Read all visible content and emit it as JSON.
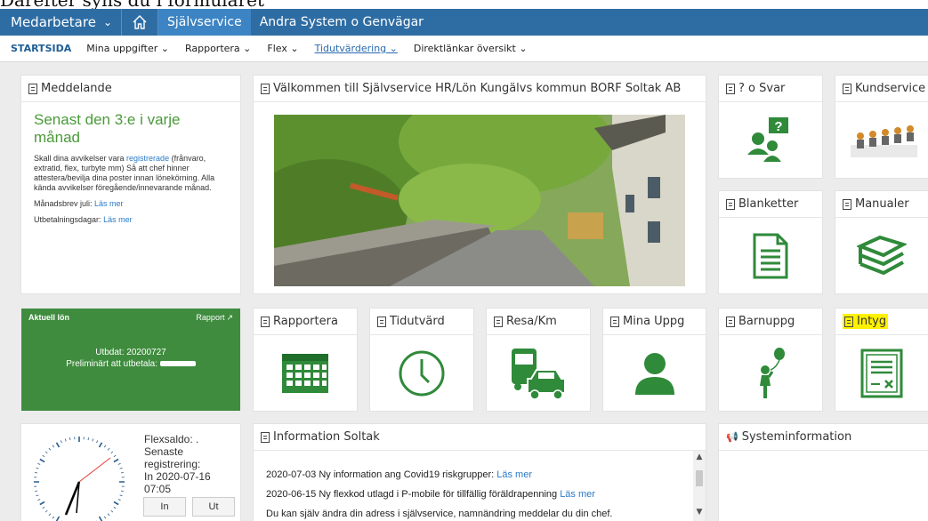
{
  "caption": "Därefter syns du i formuläret",
  "topbar": {
    "role": "Medarbetare",
    "role_caret": "⌄",
    "tabs": [
      "Självservice",
      "Andra System o Genvägar"
    ]
  },
  "subnav": {
    "items": [
      "STARTSIDA",
      "Mina uppgifter ⌄",
      "Rapportera ⌄",
      "Flex ⌄",
      "Tidutvärdering ⌄",
      "Direktlänkar översikt ⌄"
    ]
  },
  "tiles": {
    "meddelande": "Meddelande",
    "valkommen": "Välkommen till Självservice HR/Lön Kungälvs kommun BORF Soltak AB",
    "q_svar": "? o Svar",
    "kundservice": "Kundservice",
    "blanketter": "Blanketter",
    "manualer": "Manualer",
    "rapportera": "Rapportera",
    "tidutvard": "Tidutvärd",
    "resa": "Resa/Km",
    "mina_uppg": "Mina Uppg",
    "barnuppg": "Barnuppg",
    "intyg": "Intyg",
    "information": "Information Soltak",
    "systeminfo": "Systeminformation"
  },
  "meddelande": {
    "title": "Senast den 3:e i varje månad",
    "text_before": "Skall dina avvikelser vara ",
    "text_link": "registrerade",
    "text_after": " (frånvaro, extratid, flex, turbyte mm) Så att chef hinner attestera/bevilja dina poster innan lönekörning. Alla kända avvikelser föregående/innevarande månad.",
    "manadsbrev_label": "Månadsbrev juli: ",
    "manadsbrev_link": "Läs mer",
    "utbetalning_label": "Utbetalningsdagar: ",
    "utbetalning_link": "Läs mer"
  },
  "lon": {
    "title": "Aktuell lön",
    "rapport": "Rapport",
    "utbdat": "Utbdat: 20200727",
    "preliminart": "Preliminärt att utbetala: "
  },
  "flex": {
    "saldo_label": "Flexsaldo: .",
    "senaste_label": "Senaste registrering:",
    "senaste_value": "In 2020-07-16 07:05",
    "in_button": "In",
    "ut_button": "Ut"
  },
  "information": {
    "items": [
      {
        "text": "2020-07-03 Ny information ang Covid19 riskgrupper: ",
        "link": "Läs mer"
      },
      {
        "text": "2020-06-15 Ny flexkod utlagd i P-mobile för tillfällig föräldrapenning ",
        "link": "Läs mer"
      },
      {
        "text": "Du kan själv ändra din adress i självservice, namnändring meddelar du din chef.",
        "link": ""
      }
    ]
  },
  "colors": {
    "topbar": "#2e6da4",
    "tile_green": "#3f8c3e",
    "icon_green": "#2f8a3a",
    "title_green": "#4a9a3a",
    "link_blue": "#2a7ac8",
    "highlight": "#fff200"
  },
  "icons": [
    "home-icon",
    "qa-people-icon",
    "kundservice-image",
    "document-icon",
    "books-icon",
    "calendar-icon",
    "clock-icon",
    "vehicles-icon",
    "person-icon",
    "child-balloon-icon",
    "certificate-icon",
    "megaphone-icon",
    "external-link-icon"
  ]
}
